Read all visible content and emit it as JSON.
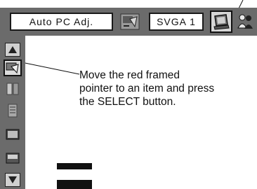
{
  "menu": {
    "mode_label": "Auto PC Adj.",
    "source_label": "SVGA 1",
    "top_icons": [
      "auto-pc-adj-icon",
      "computer-icon",
      "people-icon"
    ],
    "sidebar_icons": [
      "up-arrow-icon",
      "pc-adjust-icon",
      "image-select-icon",
      "image-adjust-icon",
      "screen-icon",
      "setting-icon",
      "down-arrow-icon"
    ]
  },
  "instruction": {
    "line1": "Move the red framed",
    "line2": "pointer to an item and press",
    "line3": "the SELECT button."
  },
  "colors": {
    "panel_gray": "#6b6b6b",
    "box_white": "#ffffff",
    "text": "#111111"
  }
}
